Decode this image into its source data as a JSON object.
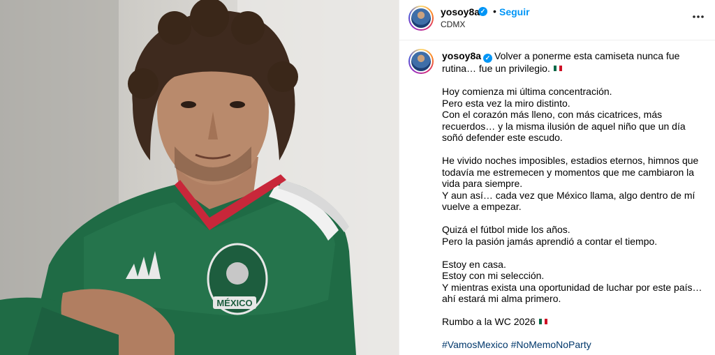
{
  "post": {
    "username": "yosoy8a",
    "follow_label": "Seguir",
    "separator": "•",
    "location": "CDMX",
    "caption": {
      "username": "yosoy8a",
      "first_line": "Volver a ponerme esta camiseta nunca fue rutina… fue un privilegio.",
      "paragraphs": [
        [
          "Hoy comienza mi última concentración.",
          "Pero esta vez la miro distinto.",
          "Con el corazón más lleno, con más cicatrices, más recuerdos… y la misma ilusión de aquel niño que un día soñó defender este escudo."
        ],
        [
          "He vivido noches imposibles, estadios eternos, himnos que todavía me estremecen y momentos que me cambiaron la vida para siempre.",
          "Y aun así… cada vez que México llama, algo dentro de mí vuelve a empezar."
        ],
        [
          "Quizá el fútbol mide los años.",
          "Pero la pasión jamás aprendió a contar el tiempo."
        ],
        [
          "Estoy en casa.",
          "Estoy con mi selección.",
          "Y mientras exista una oportunidad de luchar por este país… ahí estará mi alma primero."
        ]
      ],
      "closing": "Rumbo a la WC 2026",
      "hashtags": [
        "#VamosMexico",
        "#NoMemoNoParty"
      ]
    },
    "photo": {
      "jersey_badge_text": "MÉXICO"
    }
  },
  "colors": {
    "link_blue": "#0095f6",
    "hashtag": "#00376b",
    "jersey_green": "#1f6b45"
  },
  "icons": {
    "verified": "verified-badge-icon",
    "more": "more-options-icon",
    "flag": "mexico-flag-icon"
  }
}
